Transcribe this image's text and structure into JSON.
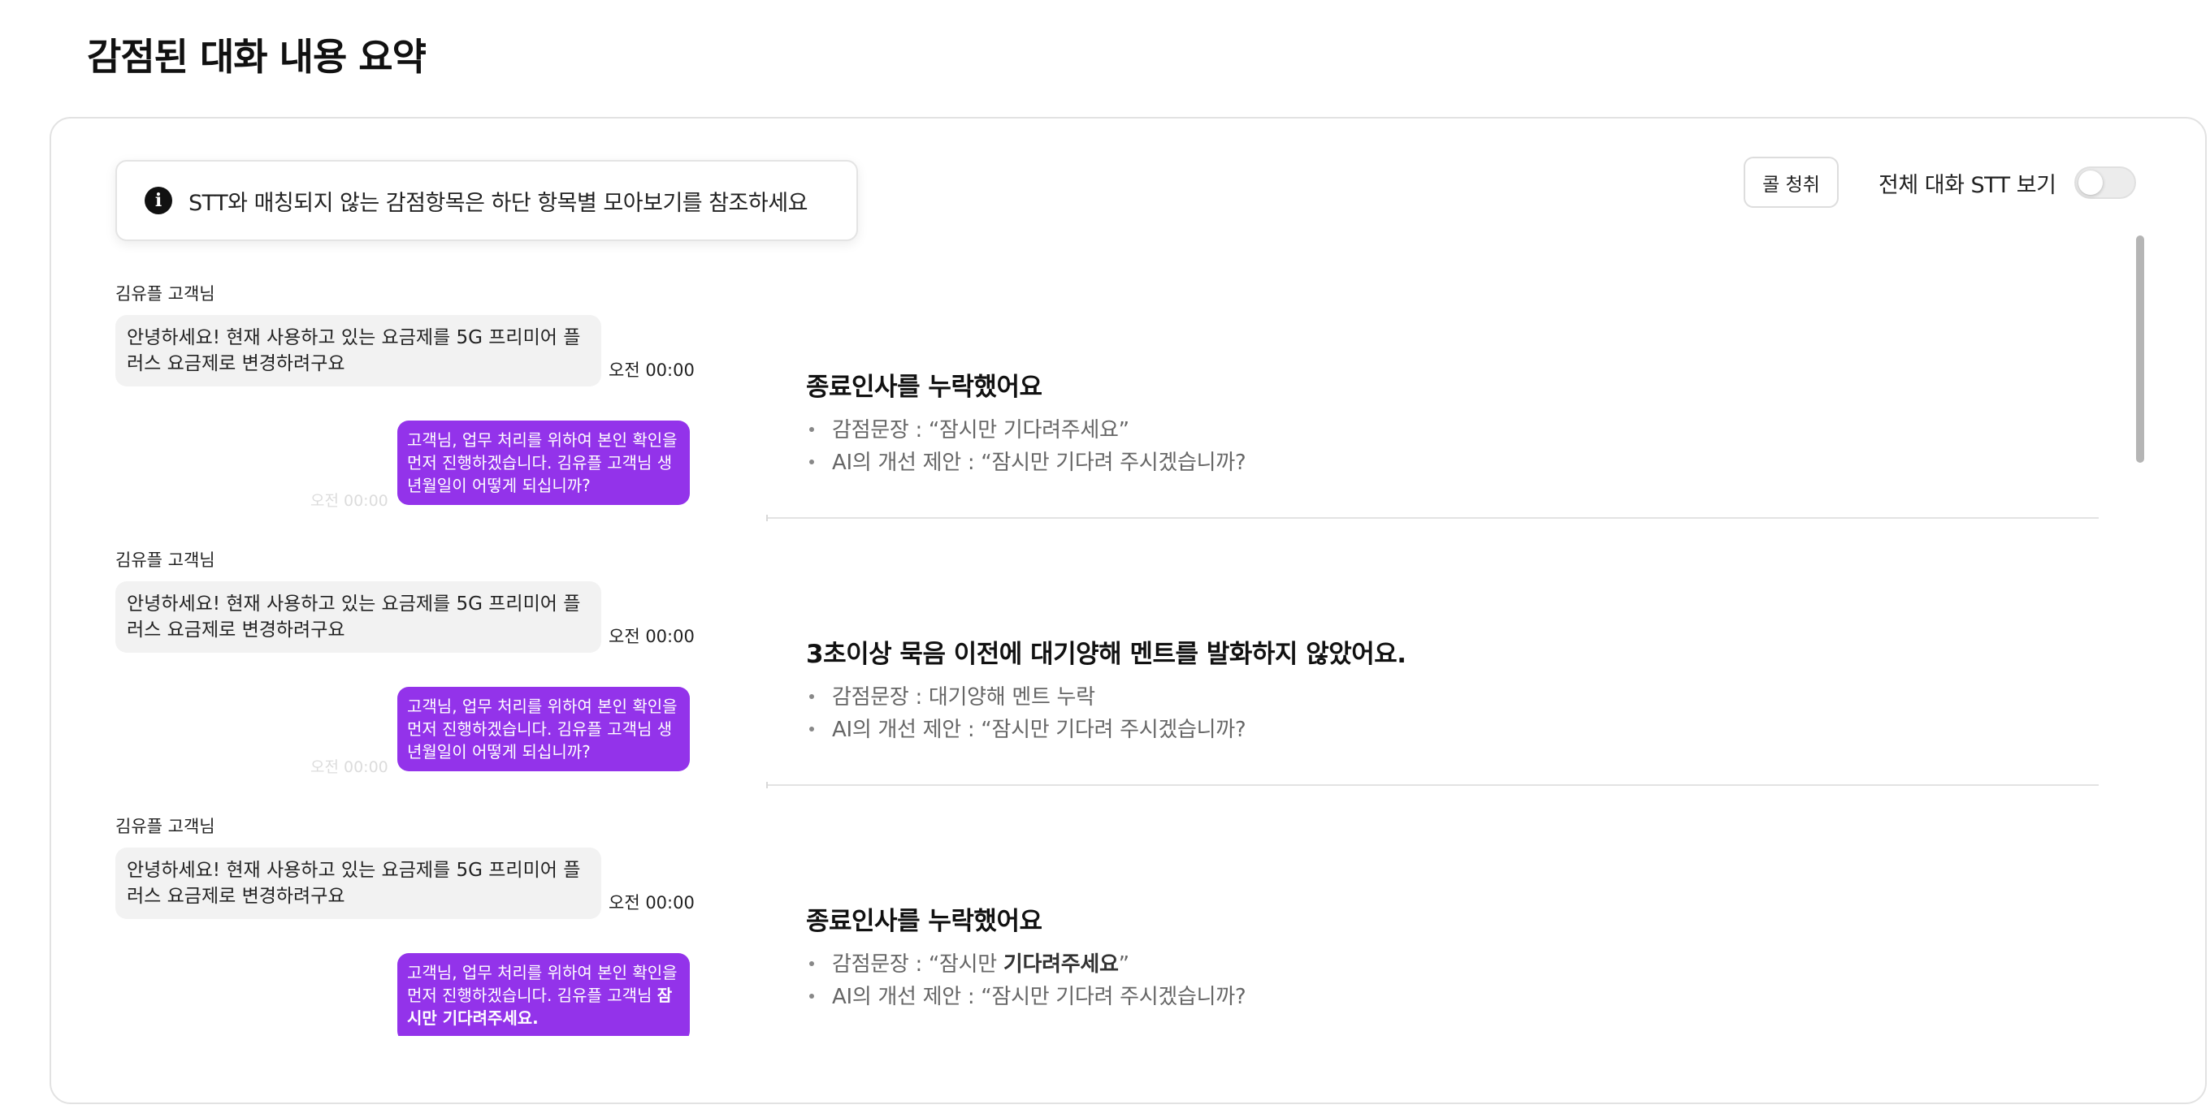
{
  "page": {
    "title": "감점된 대화 내용 요약"
  },
  "banner": {
    "icon": "info-icon",
    "text": "STT와 매칭되지 않는 감점항목은 하단 항목별 모아보기를 참조하세요"
  },
  "controls": {
    "call_button": "콜 청취",
    "toggle_label": "전체 대화 STT 보기",
    "toggle_on": false
  },
  "chat": {
    "messages": [
      {
        "sender": "김유플 고객님",
        "text": "안녕하세요! 현재 사용하고 있는 요금제를 5G 프리미어 플러스 요금제로 변경하려구요",
        "time": "오전 00:00"
      },
      {
        "text": "고객님, 업무 처리를 위하여 본인 확인을 먼저 진행하겠습니다. 김유플 고객님 생년월일이 어떻게 되십니까?",
        "time": "오전 00:00"
      },
      {
        "sender": "김유플 고객님",
        "text": "안녕하세요! 현재 사용하고 있는 요금제를 5G 프리미어 플러스 요금제로 변경하려구요",
        "time": "오전 00:00"
      },
      {
        "text": "고객님, 업무 처리를 위하여 본인 확인을 먼저 진행하겠습니다. 김유플 고객님 생년월일이 어떻게 되십니까?",
        "time": "오전 00:00"
      },
      {
        "sender": "김유플 고객님",
        "text": "안녕하세요! 현재 사용하고 있는 요금제를 5G 프리미어 플러스 요금제로 변경하려구요",
        "time": "오전 00:00"
      },
      {
        "text_prefix": "고객님, 업무 처리를 위하여 본인 확인을 먼저 진행하겠습니다. 김유플 고객님 ",
        "text_bold": "잠시만 기다려주세요."
      }
    ]
  },
  "deductions": [
    {
      "title": "종료인사를 누락했어요",
      "sentence_label": "감점문장 : ",
      "sentence": "“잠시만 기다려주세요”",
      "suggestion_label": "AI의 개선 제안 : ",
      "suggestion": "“잠시만 기다려 주시겠습니까?"
    },
    {
      "title": "3초이상 묵음 이전에 대기양해 멘트를 발화하지 않았어요.",
      "sentence_label": "감점문장 : ",
      "sentence": "대기양해 멘트 누락",
      "suggestion_label": "AI의 개선 제안 : ",
      "suggestion": "“잠시만 기다려 주시겠습니까?"
    },
    {
      "title": "종료인사를 누락했어요",
      "sentence_label": "감점문장 : ",
      "sentence_prefix": "“잠시만 ",
      "sentence_bold": "기다려주세요",
      "sentence_suffix": "”",
      "suggestion_label": "AI의 개선 제안 : ",
      "suggestion": "“잠시만 기다려 주시겠습니까?"
    }
  ]
}
